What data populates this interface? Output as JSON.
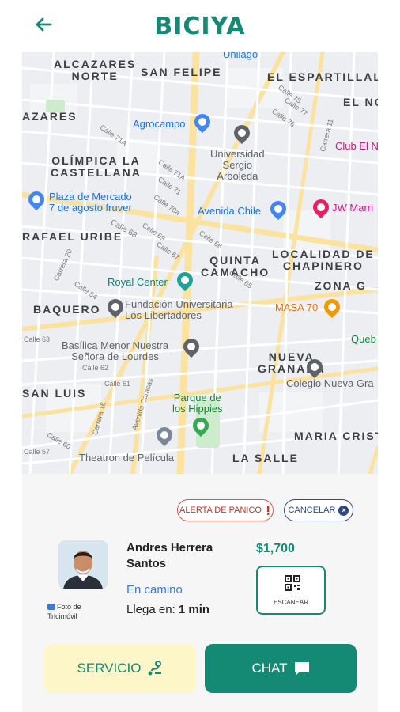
{
  "app": {
    "brand": "BICIYA",
    "accent": "#148a74"
  },
  "header": {
    "back_icon": "arrow-left-icon"
  },
  "map": {
    "areas": [
      {
        "id": "alcazares_norte",
        "text": "ALCAZARES\nNORTE"
      },
      {
        "id": "san_felipe",
        "text": "SAN FELIPE"
      },
      {
        "id": "el_espartillal",
        "text": "EL ESPARTILLAL"
      },
      {
        "id": "el_no",
        "text": "EL NO"
      },
      {
        "id": "alcazares",
        "text": "AZARES"
      },
      {
        "id": "olimpica",
        "text": "OLÍMPICA LA\nCASTELLANA"
      },
      {
        "id": "rafael_uribe",
        "text": "RAFAEL URIBE"
      },
      {
        "id": "quinta_camacho",
        "text": "QUINTA\nCAMACHO"
      },
      {
        "id": "chapinero",
        "text": "LOCALIDAD DE\nCHAPINERO"
      },
      {
        "id": "zona_g",
        "text": "ZONA G"
      },
      {
        "id": "baquero",
        "text": "BAQUERO"
      },
      {
        "id": "nueva_granada",
        "text": "NUEVA\nGRANADA"
      },
      {
        "id": "san_luis",
        "text": "SAN LUIS"
      },
      {
        "id": "maria_cristina",
        "text": "MARIA CRIST"
      },
      {
        "id": "la_salle",
        "text": "LA SALLE"
      }
    ],
    "pois": [
      {
        "id": "unilago",
        "text": "Unilago"
      },
      {
        "id": "agrocampo",
        "text": "Agrocampo"
      },
      {
        "id": "universidad",
        "text": "Universidad\nSergio\nArboleda"
      },
      {
        "id": "club",
        "text": "Club El N"
      },
      {
        "id": "plaza",
        "text": "Plaza de Mercado\n7 de agosto fruver"
      },
      {
        "id": "avenida_chile",
        "text": "Avenida Chile"
      },
      {
        "id": "jw",
        "text": "JW Marri"
      },
      {
        "id": "royal",
        "text": "Royal Center"
      },
      {
        "id": "fundacion",
        "text": "Fundación Universitaria\nLos Libertadores"
      },
      {
        "id": "masa",
        "text": "MASA 70"
      },
      {
        "id": "queb",
        "text": "Queb"
      },
      {
        "id": "basilica",
        "text": "Basílica Menor Nuestra\nSeñora de Lourdes"
      },
      {
        "id": "colegio",
        "text": "Colegio Nueva Gra"
      },
      {
        "id": "parque",
        "text": "Parque de\nlos Hippies"
      },
      {
        "id": "theatron",
        "text": "Theatron de Película"
      }
    ],
    "streets": [
      {
        "id": "s1",
        "text": "Calle 71A"
      },
      {
        "id": "s2",
        "text": "Calle 71A"
      },
      {
        "id": "s3",
        "text": "Calle 71"
      },
      {
        "id": "s4",
        "text": "Calle 70a"
      },
      {
        "id": "s5",
        "text": "Calle 69"
      },
      {
        "id": "s6",
        "text": "Calle 68"
      },
      {
        "id": "s7",
        "text": "Carrera 20"
      },
      {
        "id": "s8",
        "text": "Calle 64"
      },
      {
        "id": "s9",
        "text": "Calle 63"
      },
      {
        "id": "s10",
        "text": "Calle 62"
      },
      {
        "id": "s11",
        "text": "Calle 61"
      },
      {
        "id": "s12",
        "text": "Avenida Caracas"
      },
      {
        "id": "s13",
        "text": "Carrera 11"
      },
      {
        "id": "s14",
        "text": "Calle 76"
      },
      {
        "id": "s15",
        "text": "Calle 77"
      },
      {
        "id": "s16",
        "text": "Calle 75"
      },
      {
        "id": "s17",
        "text": "Calle 66"
      },
      {
        "id": "s18",
        "text": "Calle 57"
      },
      {
        "id": "s19",
        "text": "Calle 60"
      },
      {
        "id": "s20",
        "text": "Carrera 16"
      },
      {
        "id": "s21",
        "text": "Calle 65"
      },
      {
        "id": "s22",
        "text": "Calle 67"
      }
    ]
  },
  "trip": {
    "panic_label": "ALERTA DE PANICO",
    "cancel_label": "CANCELAR",
    "driver_name": "Andres Herrera\nSantos",
    "photo_label": "Foto de\nTricimóvil",
    "status": "En camino",
    "arrival_label": "Llega en:",
    "arrival_value": "1 min",
    "price": "$1,700",
    "scan_label": "ESCANEAR"
  },
  "actions": {
    "service_label": "SERVICIO",
    "chat_label": "CHAT"
  }
}
